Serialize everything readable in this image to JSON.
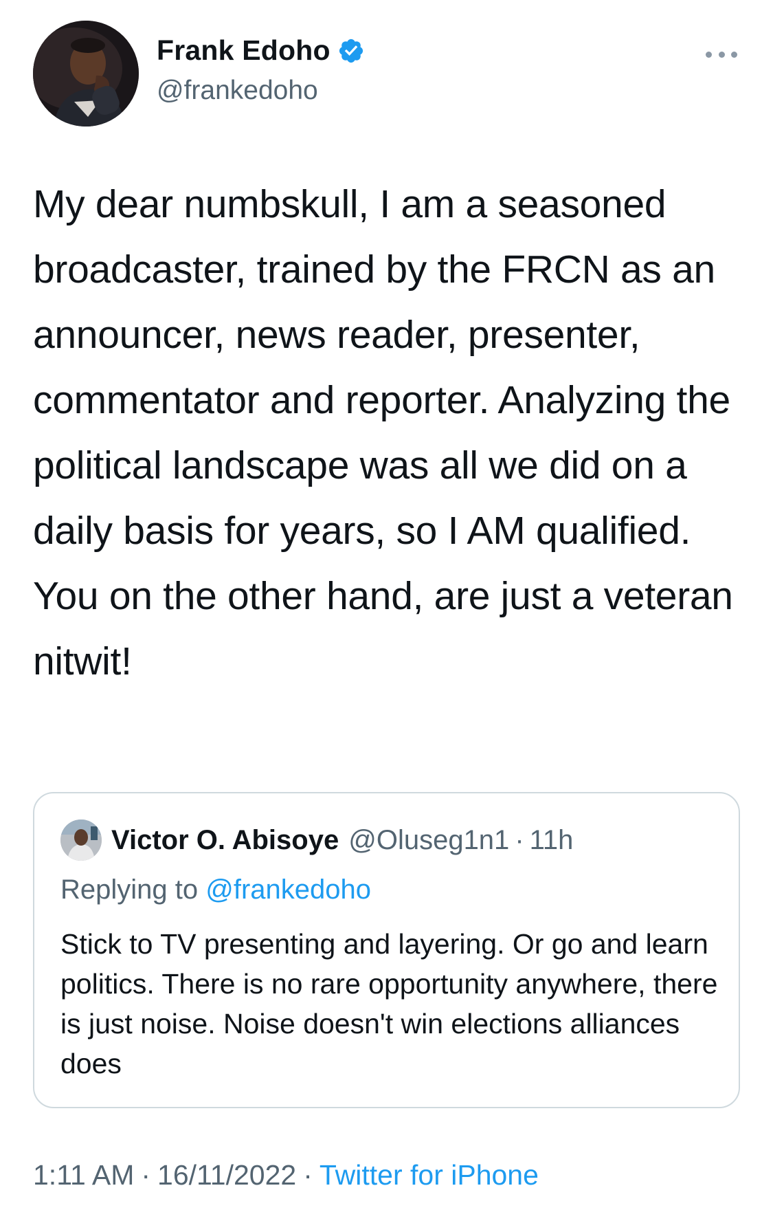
{
  "author": {
    "display_name": "Frank Edoho",
    "handle": "@frankedoho",
    "verified": true,
    "avatar_icon": "profile-photo"
  },
  "tweet": {
    "text": "My dear numbskull, I am a seasoned broadcaster, trained by the FRCN as an announcer, news reader, presenter, commentator and reporter. Analyzing the political landscape was all we did on a daily basis for years, so I AM qualified. You on the other hand, are just a veteran nitwit!"
  },
  "quoted_tweet": {
    "display_name": "Victor O. Abisoye",
    "handle": "@Oluseg1n1",
    "separator": "·",
    "time": "11h",
    "replying_prefix": "Replying to",
    "replying_to": "@frankedoho",
    "text": "Stick to TV presenting and layering. Or go and learn politics. There is no rare opportunity anywhere, there is just noise. Noise doesn't win elections alliances does"
  },
  "meta": {
    "time": "1:11 AM",
    "separator": "·",
    "date": "16/11/2022",
    "source": "Twitter for iPhone"
  },
  "colors": {
    "accent": "#1d9bf0",
    "secondary_text": "#536471",
    "border": "#cfd9de"
  }
}
